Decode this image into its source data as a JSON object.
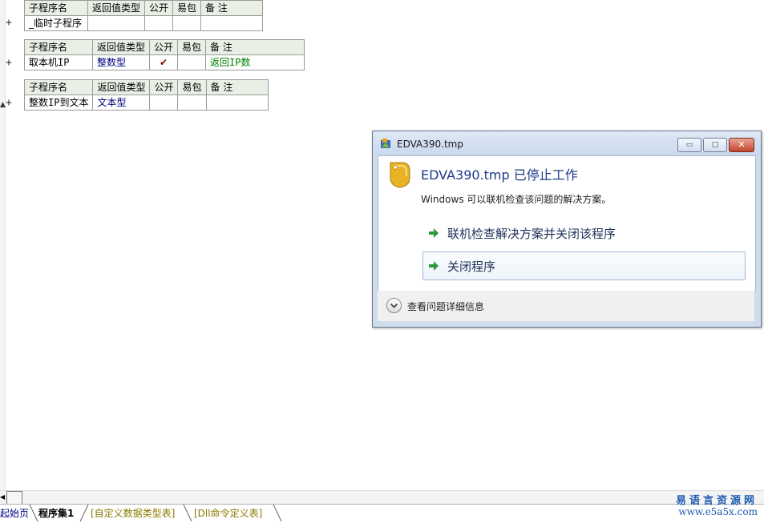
{
  "editor": {
    "header": {
      "name": "子程序名",
      "return_type": "返回值类型",
      "public": "公开",
      "easy_pack": "易包",
      "remark": "备 注"
    },
    "subs": [
      {
        "name": "_临时子程序",
        "return_type": "",
        "public": "",
        "easy_pack": "",
        "remark": ""
      },
      {
        "name": "取本机IP",
        "return_type": "整数型",
        "public": "✔",
        "easy_pack": "",
        "remark": "返回IP数"
      },
      {
        "name": "整数IP到文本",
        "return_type": "文本型",
        "public": "",
        "easy_pack": "",
        "remark": ""
      }
    ],
    "expand_symbol": "+",
    "cursor_symbol": "▲"
  },
  "dialog": {
    "title": "EDVA390.tmp",
    "heading": "EDVA390.tmp 已停止工作",
    "message": "Windows 可以联机检查该问题的解决方案。",
    "actions": [
      {
        "label": "联机检查解决方案并关闭该程序"
      },
      {
        "label": "关闭程序"
      }
    ],
    "details_label": "查看问题详细信息",
    "controls": {
      "minimize": "▭",
      "maximize": "□",
      "close": "✕"
    }
  },
  "tabs": [
    {
      "label": "起始页"
    },
    {
      "label": "程序集1"
    },
    {
      "label": "[自定义数据类型表]"
    },
    {
      "label": "[Dll命令定义表]"
    }
  ],
  "watermark": {
    "line1": "易语言资源网",
    "line2": "www.e5a5x.com"
  },
  "icons": [
    "app-icon",
    "shield-icon",
    "arrow-icon",
    "chevron-down-icon",
    "plus-icon"
  ]
}
